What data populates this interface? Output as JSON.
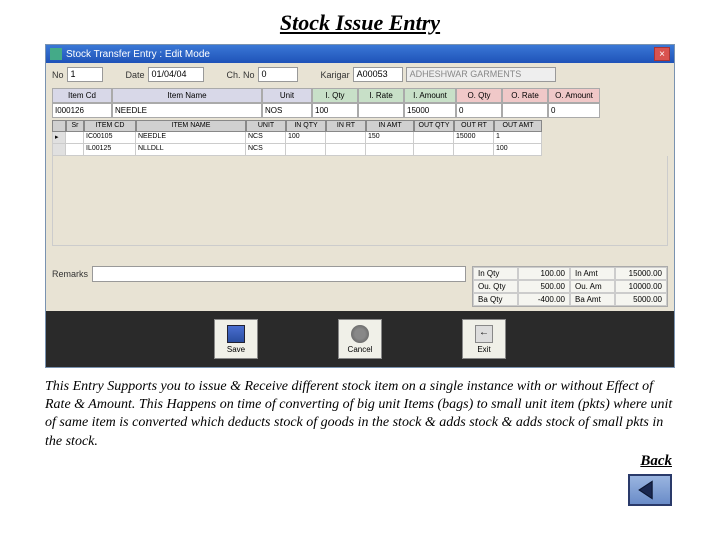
{
  "title": "Stock Issue Entry",
  "window_title": "Stock Transfer Entry : Edit Mode",
  "header": {
    "no_lbl": "No",
    "no_val": "1",
    "date_lbl": "Date",
    "date_val": "01/04/04",
    "chno_lbl": "Ch. No",
    "chno_val": "0",
    "karigar_lbl": "Karigar",
    "karigar_val": "A00053",
    "karigar_name": "ADHESHWAR GARMENTS"
  },
  "cols": {
    "itemcd": "Item Cd",
    "itemname": "Item Name",
    "unit": "Unit",
    "iqty": "I. Qty",
    "irate": "I. Rate",
    "iamt": "I. Amount",
    "oqty": "O. Qty",
    "orate": "O. Rate",
    "oamt": "O. Amount"
  },
  "entry": {
    "code": "I000126",
    "name": "NEEDLE",
    "unit": "NOS",
    "iqty": "100",
    "irate": "",
    "iamt": "15000",
    "oqty": "0",
    "orate": "",
    "oamt": "0"
  },
  "gridcols": {
    "sr": "Sr",
    "code": "ITEM CD",
    "name": "ITEM NAME",
    "unit": "UNIT",
    "iq": "IN QTY",
    "ir": "IN RT",
    "ia": "IN AMT",
    "oq": "OUT QTY",
    "or": "OUT RT",
    "oa": "OUT AMT"
  },
  "gridrows": [
    {
      "sr": "",
      "code": "IC00105",
      "name": "NEEDLE",
      "unit": "NCS",
      "iq": "100",
      "ir": "",
      "ia": "150",
      "oq": "",
      "or": "15000",
      "oa": "1"
    },
    {
      "sr": "",
      "code": "IL00125",
      "name": "NLLDLL",
      "unit": "NCS",
      "iq": "",
      "ir": "",
      "ia": "",
      "oq": "",
      "or": "",
      "oa": "100"
    }
  ],
  "remarks_lbl": "Remarks",
  "summary": {
    "inqty_l": "In Qty",
    "inqty_v": "100.00",
    "inamt_l": "In Amt",
    "inamt_v": "15000.00",
    "ouqty_l": "Ou. Qty",
    "ouqty_v": "500.00",
    "ouamt_l": "Ou. Am",
    "ouamt_v": "10000.00",
    "baqty_l": "Ba Qty",
    "baqty_v": "-400.00",
    "baamt_l": "Ba Amt",
    "baamt_v": "5000.00"
  },
  "buttons": {
    "save": "Save",
    "cancel": "Cancel",
    "exit": "Exit"
  },
  "description": "This Entry Supports you to issue & Receive different stock item on a single instance with or without Effect of Rate & Amount. This Happens on time of converting of big unit Items (bags) to small unit item (pkts) where unit of same item is converted which deducts stock of goods in the stock & adds stock & adds stock of small pkts in the stock.",
  "back": "Back"
}
